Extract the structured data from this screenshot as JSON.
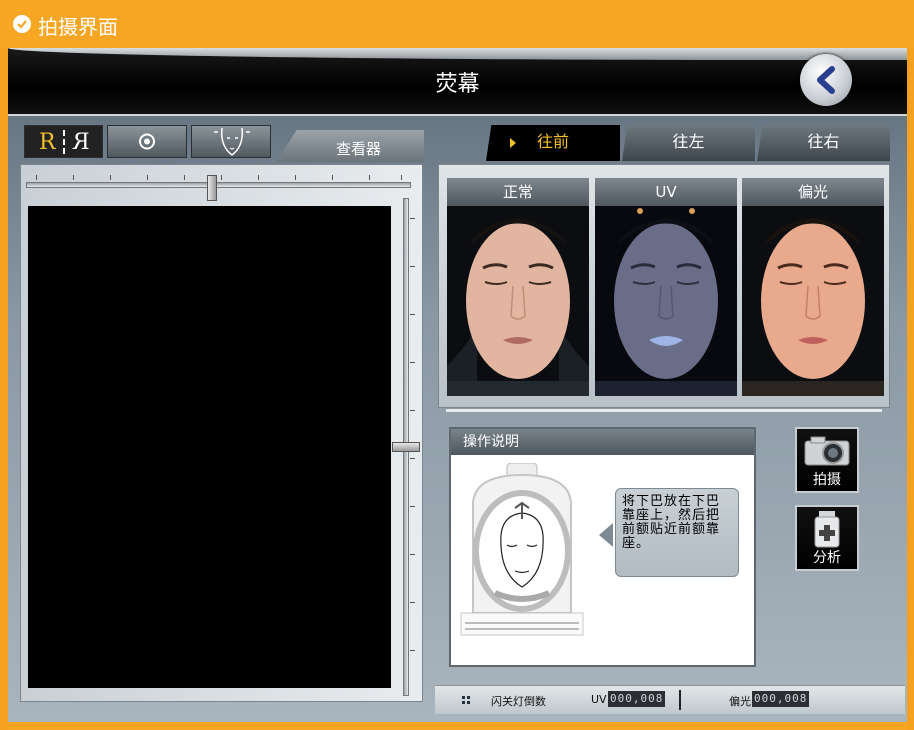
{
  "window": {
    "title": "拍摄界面"
  },
  "header": {
    "title": "荧幕"
  },
  "toolbar": {
    "mirror_left": "R",
    "mirror_right": "R",
    "viewer_tab_label": "查看器"
  },
  "direction_tabs": [
    {
      "label": "往前",
      "active": true
    },
    {
      "label": "往左",
      "active": false
    },
    {
      "label": "往右",
      "active": false
    }
  ],
  "photos": [
    {
      "label": "正常",
      "mode": "normal"
    },
    {
      "label": "UV",
      "mode": "uv"
    },
    {
      "label": "偏光",
      "mode": "polarized"
    }
  ],
  "instructions": {
    "title": "操作说明",
    "text": "将下巴放在下巴靠座上，然后把前额贴近前额靠座。"
  },
  "actions": {
    "shoot_label": "拍摄",
    "analyze_label": "分析"
  },
  "status": {
    "flash_label": "闪关灯倒数",
    "uv_label": "UV",
    "uv_value": "000,008",
    "pol_label": "偏光",
    "pol_value": "000,008"
  },
  "colors": {
    "brand_orange": "#f7a624",
    "active_tab_text": "#f2c12a"
  }
}
